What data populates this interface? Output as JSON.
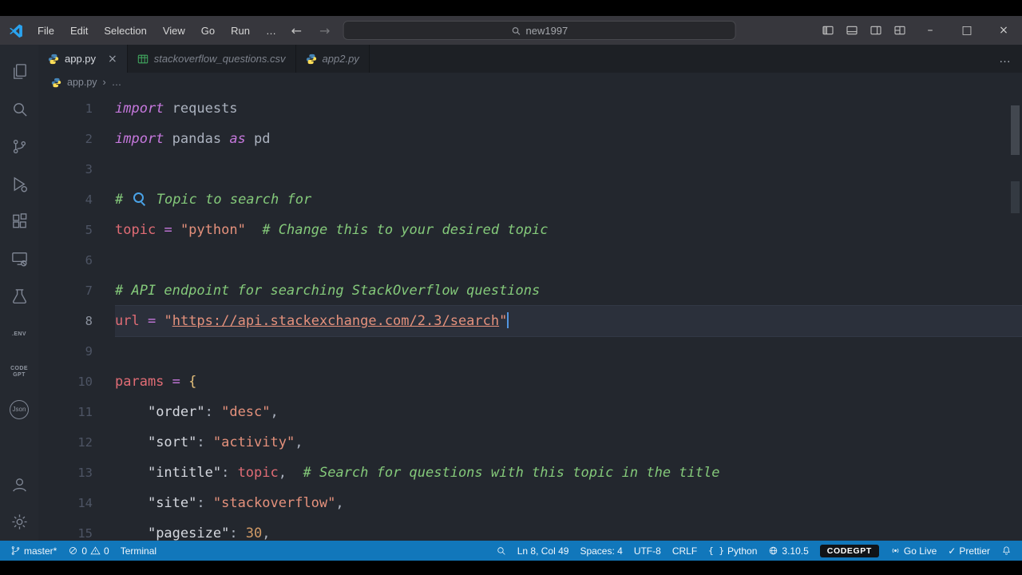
{
  "colors": {
    "statusbar_blue": "#1177bb",
    "editor_background": "#23272e",
    "titlebar_gray": "#37373d",
    "keyword_purple": "#c678dd",
    "string_salmon": "#e5917c",
    "comment_green": "#84c97a",
    "variable_red": "#e06c75",
    "accent_blue": "#4aa3e8"
  },
  "icons": {
    "back_arrow": "←",
    "forward_arrow": "→",
    "ellipsis": "…",
    "chevron_down": "▾",
    "minimize": "–",
    "maximize": "□",
    "close": "×",
    "check": "✓",
    "braces": "{ }",
    "breadcrumb_separator": "›"
  },
  "titlebar": {
    "menus": [
      "File",
      "Edit",
      "Selection",
      "View",
      "Go",
      "Run"
    ],
    "search_value": "new1997"
  },
  "tabs": [
    {
      "label": "app.py",
      "active": true
    },
    {
      "label": "stackoverflow_questions.csv",
      "active": false
    },
    {
      "label": "app2.py",
      "active": false
    }
  ],
  "breadcrumb": {
    "file": "app.py",
    "more": "…"
  },
  "activity_bar": {
    "env_label": ".ENV",
    "codegpt_line1": "CODE",
    "codegpt_line2": "GPT",
    "json_label": "Json"
  },
  "editor": {
    "lines": [
      {
        "num": "1",
        "tokens": [
          {
            "t": "kw",
            "s": "import"
          },
          {
            "t": "pl",
            "s": " requests"
          }
        ]
      },
      {
        "num": "2",
        "tokens": [
          {
            "t": "kw",
            "s": "import"
          },
          {
            "t": "pl",
            "s": " pandas "
          },
          {
            "t": "kw",
            "s": "as"
          },
          {
            "t": "pl",
            "s": " pd"
          }
        ]
      },
      {
        "num": "3",
        "tokens": []
      },
      {
        "num": "4",
        "tokens": [
          {
            "t": "cm",
            "s": "# "
          },
          {
            "t": "glyph-search",
            "s": ""
          },
          {
            "t": "cm",
            "s": " Topic to search for"
          }
        ]
      },
      {
        "num": "5",
        "tokens": [
          {
            "t": "var",
            "s": "topic"
          },
          {
            "t": "pl",
            "s": " "
          },
          {
            "t": "op",
            "s": "="
          },
          {
            "t": "pl",
            "s": " "
          },
          {
            "t": "str",
            "s": "\"python\""
          },
          {
            "t": "pl",
            "s": "  "
          },
          {
            "t": "cm",
            "s": "# Change this to your desired topic"
          }
        ]
      },
      {
        "num": "6",
        "tokens": []
      },
      {
        "num": "7",
        "tokens": [
          {
            "t": "cm",
            "s": "# API endpoint for searching StackOverflow questions"
          }
        ]
      },
      {
        "num": "8",
        "active": true,
        "cursor": true,
        "tokens": [
          {
            "t": "var",
            "s": "url"
          },
          {
            "t": "pl",
            "s": " "
          },
          {
            "t": "op",
            "s": "="
          },
          {
            "t": "pl",
            "s": " "
          },
          {
            "t": "str",
            "s": "\""
          },
          {
            "t": "link",
            "s": "https://api.stackexchange.com/2.3/search"
          },
          {
            "t": "str",
            "s": "\""
          }
        ]
      },
      {
        "num": "9",
        "tokens": []
      },
      {
        "num": "10",
        "tokens": [
          {
            "t": "var",
            "s": "params"
          },
          {
            "t": "pl",
            "s": " "
          },
          {
            "t": "op",
            "s": "="
          },
          {
            "t": "pl",
            "s": " "
          },
          {
            "t": "br",
            "s": "{"
          }
        ]
      },
      {
        "num": "11",
        "tokens": [
          {
            "t": "pl",
            "s": "    "
          },
          {
            "t": "key",
            "s": "\"order\""
          },
          {
            "t": "pu",
            "s": ": "
          },
          {
            "t": "str",
            "s": "\"desc\""
          },
          {
            "t": "pu",
            "s": ","
          }
        ]
      },
      {
        "num": "12",
        "tokens": [
          {
            "t": "pl",
            "s": "    "
          },
          {
            "t": "key",
            "s": "\"sort\""
          },
          {
            "t": "pu",
            "s": ": "
          },
          {
            "t": "str",
            "s": "\"activity\""
          },
          {
            "t": "pu",
            "s": ","
          }
        ]
      },
      {
        "num": "13",
        "tokens": [
          {
            "t": "pl",
            "s": "    "
          },
          {
            "t": "key",
            "s": "\"intitle\""
          },
          {
            "t": "pu",
            "s": ": "
          },
          {
            "t": "var",
            "s": "topic"
          },
          {
            "t": "pu",
            "s": ","
          },
          {
            "t": "pl",
            "s": "  "
          },
          {
            "t": "cm",
            "s": "# Search for questions with this topic in the title"
          }
        ]
      },
      {
        "num": "14",
        "tokens": [
          {
            "t": "pl",
            "s": "    "
          },
          {
            "t": "key",
            "s": "\"site\""
          },
          {
            "t": "pu",
            "s": ": "
          },
          {
            "t": "str",
            "s": "\"stackoverflow\""
          },
          {
            "t": "pu",
            "s": ","
          }
        ]
      },
      {
        "num": "15",
        "tokens": [
          {
            "t": "pl",
            "s": "    "
          },
          {
            "t": "key",
            "s": "\"pagesize\""
          },
          {
            "t": "pu",
            "s": ": "
          },
          {
            "t": "num",
            "s": "30"
          },
          {
            "t": "pu",
            "s": ","
          }
        ]
      }
    ]
  },
  "status_bar": {
    "branch": "master*",
    "errors": "0",
    "warnings": "0",
    "terminal": "Terminal",
    "cursor_position": "Ln 8, Col 49",
    "indentation": "Spaces: 4",
    "encoding": "UTF-8",
    "eol": "CRLF",
    "language": "Python",
    "python_version": "3.10.5",
    "codegpt": "CODEGPT",
    "go_live": "Go Live",
    "prettier": "Prettier"
  }
}
